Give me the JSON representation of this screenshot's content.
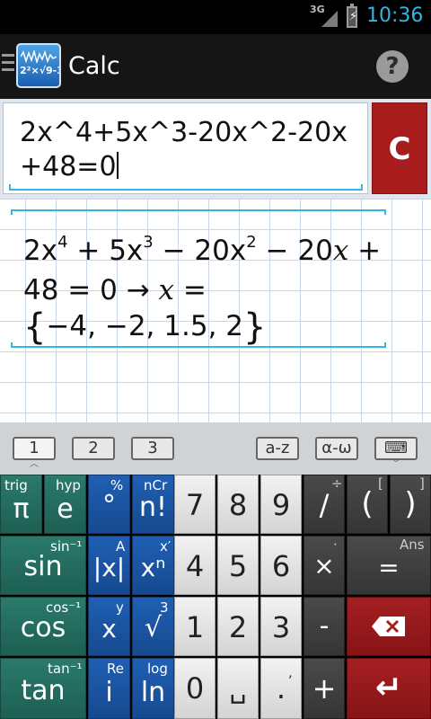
{
  "status": {
    "network": "3G",
    "battery_label": "⚡",
    "time": "10:36"
  },
  "actionbar": {
    "title": "Calc",
    "logo_text": "2²×√9-3/2",
    "help_label": "?"
  },
  "input": {
    "expression": "2x^4+5x^3-20x^2-20x+48=0"
  },
  "clear_label": "C",
  "result": {
    "line1": {
      "c1": "2x",
      "e1": "4",
      "c2": " + 5x",
      "e2": "3",
      "c3": " − 20x",
      "e3": "2",
      "c4": " − 20",
      "v": "x",
      "c5": " +"
    },
    "line2": {
      "text": "48 = 0 → ",
      "var": "x",
      "eq": " ="
    },
    "line3": {
      "open": "{",
      "values": "−4, −2, 1.5, 2",
      "close": "}"
    }
  },
  "tabs": {
    "t1": "1",
    "t2": "2",
    "t3": "3",
    "az": "a-z",
    "greek": "α-ω",
    "keyboard": "⌨",
    "caret_up": "︿",
    "caret_down": "﹀"
  },
  "keys": {
    "r1": {
      "pi": "π",
      "pi_sec": "trig",
      "e": "e",
      "e_sec": "hyp",
      "deg": "°",
      "deg_sec": "%",
      "fact": "n!",
      "fact_sec": "nCr",
      "n7": "7",
      "n8": "8",
      "n9": "9",
      "div": "/",
      "div_sec": "÷",
      "lparen": "(",
      "lparen_sec": "[",
      "rparen": ")",
      "rparen_sec": "]"
    },
    "r2": {
      "sin": "sin",
      "sin_sec": "sin⁻¹",
      "abs": "|x|",
      "abs_sec": "A",
      "pow": "xⁿ",
      "pow_sec": "x′",
      "n4": "4",
      "n5": "5",
      "n6": "6",
      "mul": "×",
      "mul_sec": "·",
      "eq": "=",
      "eq_sec": "Ans"
    },
    "r3": {
      "cos": "cos",
      "cos_sec": "cos⁻¹",
      "x": "x",
      "x_sec": "y",
      "sqrt": "√",
      "sqrt_sec": "3",
      "n1": "1",
      "n2": "2",
      "n3": "3",
      "minus": "-",
      "backspace": "⌫"
    },
    "r4": {
      "tan": "tan",
      "tan_sec": "tan⁻¹",
      "i": "i",
      "i_sec": "Re",
      "ln": "ln",
      "ln_sec": "log",
      "n0": "0",
      "space": "␣",
      "dot": ".",
      "dot_sec": ",",
      "plus": "+",
      "enter": "↵"
    }
  },
  "colors": {
    "teal": "#1d5f53",
    "blue": "#164a8f",
    "red": "#a51f22",
    "accent": "#33b5e5"
  }
}
